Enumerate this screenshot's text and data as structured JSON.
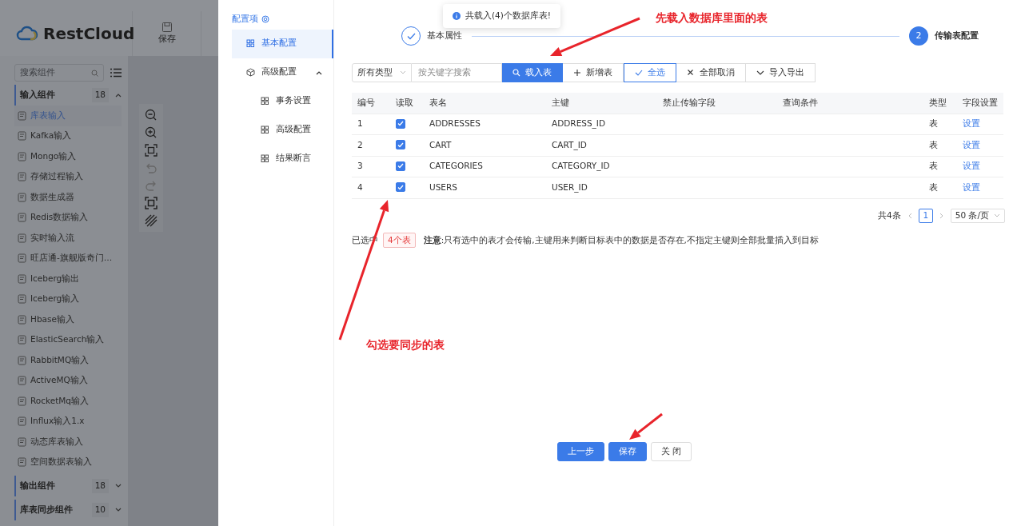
{
  "app": {
    "logo": "RestCloud",
    "toolbar": [
      {
        "label": "保存"
      }
    ],
    "search": {
      "placeholder": "搜索组件"
    },
    "groups": [
      {
        "title": "输入组件",
        "count": "18",
        "expanded": true,
        "items": [
          {
            "label": "库表输入",
            "selected": true
          },
          {
            "label": "Kafka输入",
            "selected": false
          },
          {
            "label": "Mongo输入",
            "selected": false
          },
          {
            "label": "存储过程输入",
            "selected": false
          },
          {
            "label": "数据生成器",
            "selected": false
          },
          {
            "label": "Redis数据输入",
            "selected": false
          },
          {
            "label": "实时输入流",
            "selected": false
          },
          {
            "label": "旺店通-旗舰版奇门…",
            "selected": false
          },
          {
            "label": "Iceberg输出",
            "selected": false
          },
          {
            "label": "Iceberg输入",
            "selected": false
          },
          {
            "label": "Hbase输入",
            "selected": false
          },
          {
            "label": "ElasticSearch输入",
            "selected": false
          },
          {
            "label": "RabbitMQ输入",
            "selected": false
          },
          {
            "label": "ActiveMQ输入",
            "selected": false
          },
          {
            "label": "RocketMq输入",
            "selected": false
          },
          {
            "label": "Influx输入1.x",
            "selected": false
          },
          {
            "label": "动态库表输入",
            "selected": false
          },
          {
            "label": "空间数据表输入",
            "selected": false
          }
        ]
      },
      {
        "title": "输出组件",
        "count": "18",
        "expanded": false
      },
      {
        "title": "库表同步组件",
        "count": "10",
        "expanded": false
      }
    ]
  },
  "drawer": {
    "nav": {
      "title": "配置项",
      "items": [
        {
          "label": "基本配置",
          "selected": true
        },
        {
          "label": "高级配置",
          "selected": false,
          "expanded": true,
          "children": [
            {
              "label": "事务设置"
            },
            {
              "label": "高级配置"
            },
            {
              "label": "结果断言"
            }
          ]
        }
      ]
    },
    "toast": "共载入(4)个数据库表!",
    "steps": [
      {
        "label": "基本属性",
        "done": true,
        "active": false
      },
      {
        "number": "2",
        "label": "传输表配置",
        "done": false,
        "active": true
      }
    ],
    "filter": {
      "type": "所有类型",
      "placeholder": "按关键字搜索"
    },
    "buttons": [
      {
        "label": "载入表",
        "kind": "primary"
      },
      {
        "label": "新增表",
        "kind": "add"
      },
      {
        "label": "全选",
        "kind": "check"
      },
      {
        "label": "全部取消",
        "kind": "cancel"
      },
      {
        "label": "导入导出",
        "kind": "menu"
      }
    ],
    "table": {
      "columns": [
        "编号",
        "读取",
        "表名",
        "主键",
        "禁止传输字段",
        "查询条件",
        "类型",
        "字段设置"
      ],
      "rows": [
        {
          "number": "1",
          "checked": true,
          "name": "ADDRESSES",
          "key": "ADDRESS_ID",
          "type": "表",
          "action": "设置"
        },
        {
          "number": "2",
          "checked": true,
          "name": "CART",
          "key": "CART_ID",
          "type": "表",
          "action": "设置"
        },
        {
          "number": "3",
          "checked": true,
          "name": "CATEGORIES",
          "key": "CATEGORY_ID",
          "type": "表",
          "action": "设置"
        },
        {
          "number": "4",
          "checked": true,
          "name": "USERS",
          "key": "USER_ID",
          "type": "表",
          "action": "设置"
        }
      ]
    },
    "pagination": {
      "total": "共4条",
      "pages": [
        {
          "label": "1",
          "selected": true
        }
      ],
      "page_size": "50 条/页"
    },
    "selection": {
      "label": "已选中",
      "count": "4个表",
      "note": "**注意**:只有选中的表才会传输,主键用来判断目标表中的数据是否存在,不指定主键则全部批量插入到目标"
    },
    "footer_buttons": [
      {
        "label": "上一步",
        "kind": "primary"
      },
      {
        "label": "保存",
        "kind": "primary"
      },
      {
        "label": "关 闭",
        "kind": "default"
      }
    ]
  },
  "annotations": [
    {
      "text": "先载入数据库里面的表"
    },
    {
      "text": "勾选要同步的表"
    }
  ]
}
